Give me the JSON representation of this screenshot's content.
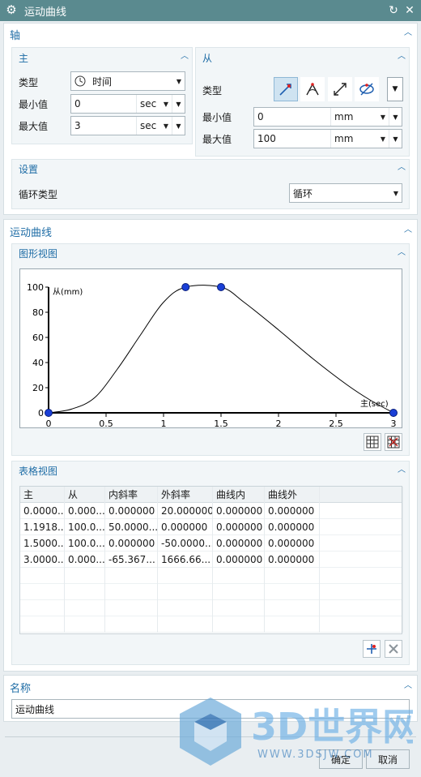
{
  "window": {
    "title": "运动曲线"
  },
  "axis": {
    "header": "轴",
    "master": {
      "header": "主",
      "type_label": "类型",
      "type_value": "时间",
      "min_label": "最小值",
      "min_value": "0",
      "min_unit": "sec",
      "max_label": "最大值",
      "max_value": "3",
      "max_unit": "sec"
    },
    "follower": {
      "header": "从",
      "type_label": "类型",
      "type_icons": [
        "linear-motion-icon",
        "angular-motion-icon",
        "two-way-arrow-icon",
        "rotation-icon"
      ],
      "min_label": "最小值",
      "min_value": "0",
      "min_unit": "mm",
      "max_label": "最大值",
      "max_value": "100",
      "max_unit": "mm"
    },
    "settings": {
      "header": "设置",
      "loop_label": "循环类型",
      "loop_value": "循环"
    }
  },
  "motion": {
    "header": "运动曲线",
    "graph_header": "图形视图",
    "table_header": "表格视图",
    "y_label": "从(mm)",
    "x_label": "主(sec)"
  },
  "chart_data": {
    "type": "line",
    "xlabel": "主(sec)",
    "ylabel": "从(mm)",
    "xlim": [
      0,
      3
    ],
    "ylim": [
      0,
      100
    ],
    "x_ticks": [
      "0",
      "0.5",
      "1",
      "1.5",
      "2",
      "2.5",
      "3"
    ],
    "y_ticks": [
      "0",
      "20",
      "40",
      "60",
      "80",
      "100"
    ],
    "control_points": [
      {
        "x": 0,
        "y": 0
      },
      {
        "x": 1.1918,
        "y": 100
      },
      {
        "x": 1.5,
        "y": 100
      },
      {
        "x": 3,
        "y": 0
      }
    ],
    "curve": [
      [
        0,
        0
      ],
      [
        0.2,
        3
      ],
      [
        0.4,
        12
      ],
      [
        0.6,
        35
      ],
      [
        0.8,
        62
      ],
      [
        1.0,
        88
      ],
      [
        1.1918,
        100
      ],
      [
        1.5,
        100
      ],
      [
        1.7,
        88
      ],
      [
        2.0,
        66
      ],
      [
        2.3,
        43
      ],
      [
        2.6,
        22
      ],
      [
        2.8,
        10
      ],
      [
        3.0,
        0
      ]
    ]
  },
  "table": {
    "columns": [
      "主",
      "从",
      "内斜率",
      "外斜率",
      "曲线内",
      "曲线外"
    ],
    "rows": [
      [
        "0.0000...",
        "0.000...",
        "0.000000",
        "20.000000",
        "0.000000",
        "0.000000"
      ],
      [
        "1.1918...",
        "100.0...",
        "50.0000...",
        "0.000000",
        "0.000000",
        "0.000000"
      ],
      [
        "1.5000...",
        "100.0...",
        "0.000000",
        "-50.0000...",
        "0.000000",
        "0.000000"
      ],
      [
        "3.0000...",
        "0.000...",
        "-65.367...",
        "1666.66...",
        "0.000000",
        "0.000000"
      ]
    ]
  },
  "name": {
    "header": "名称",
    "value": "运动曲线"
  },
  "watermark": {
    "brand": "3D世界网",
    "url": "WWW.3DSJW.COM"
  },
  "footer": {
    "ok": "确定",
    "cancel": "取消"
  }
}
